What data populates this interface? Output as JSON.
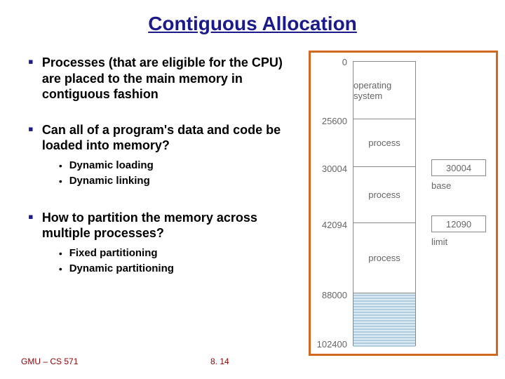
{
  "title": "Contiguous Allocation",
  "bullets": {
    "b1": "Processes (that are eligible for the CPU) are placed to the main memory in contiguous fashion",
    "b2": "Can all of a program's data and code be loaded into memory?",
    "b2s1": "Dynamic loading",
    "b2s2": "Dynamic linking",
    "b3": "How to partition the memory across multiple processes?",
    "b3s1": "Fixed partitioning",
    "b3s2": "Dynamic partitioning"
  },
  "footer": {
    "left": "GMU – CS 571",
    "center": "8. 14"
  },
  "diagram": {
    "addresses": [
      "0",
      "25600",
      "30004",
      "42094",
      "88000",
      "102400"
    ],
    "segments": {
      "os": "operating system",
      "proc": "process"
    },
    "side": {
      "base_val": "30004",
      "base_lbl": "base",
      "limit_val": "12090",
      "limit_lbl": "limit"
    }
  }
}
